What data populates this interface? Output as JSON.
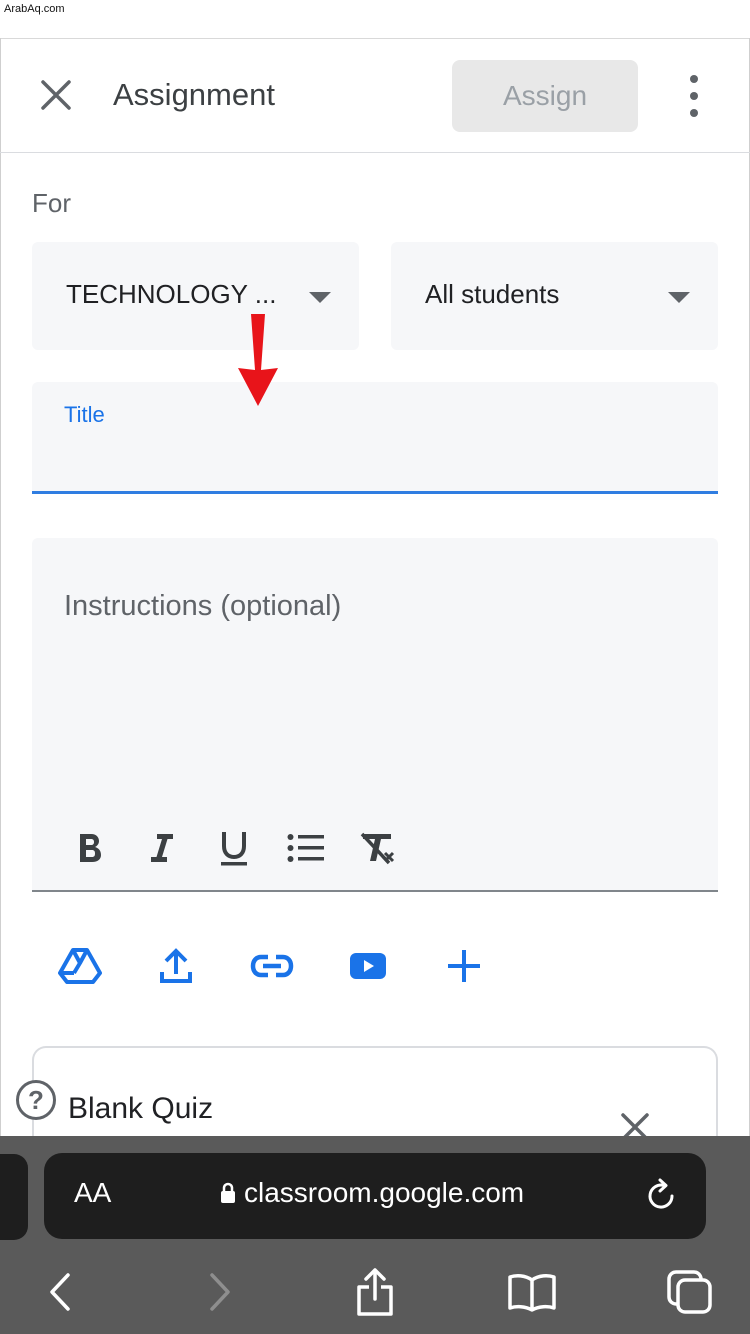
{
  "watermark": "ArabAq.com",
  "header": {
    "title": "Assignment",
    "assign_label": "Assign"
  },
  "for_section": {
    "label": "For",
    "class_select": "TECHNOLOGY ...",
    "students_select": "All students"
  },
  "title_field": {
    "label": "Title",
    "value": ""
  },
  "instructions_field": {
    "placeholder": "Instructions (optional)",
    "format_buttons": [
      "bold",
      "italic",
      "underline",
      "bulleted-list",
      "clear-formatting"
    ]
  },
  "attach_buttons": [
    "google-drive",
    "upload",
    "link",
    "youtube",
    "create"
  ],
  "quiz_card": {
    "title": "Blank Quiz"
  },
  "browser": {
    "aa_label": "AA",
    "url": "classroom.google.com"
  },
  "colors": {
    "accent": "#1a73e8",
    "annotation_arrow": "#e8141a",
    "safari_bar": "#5a5a5a"
  }
}
